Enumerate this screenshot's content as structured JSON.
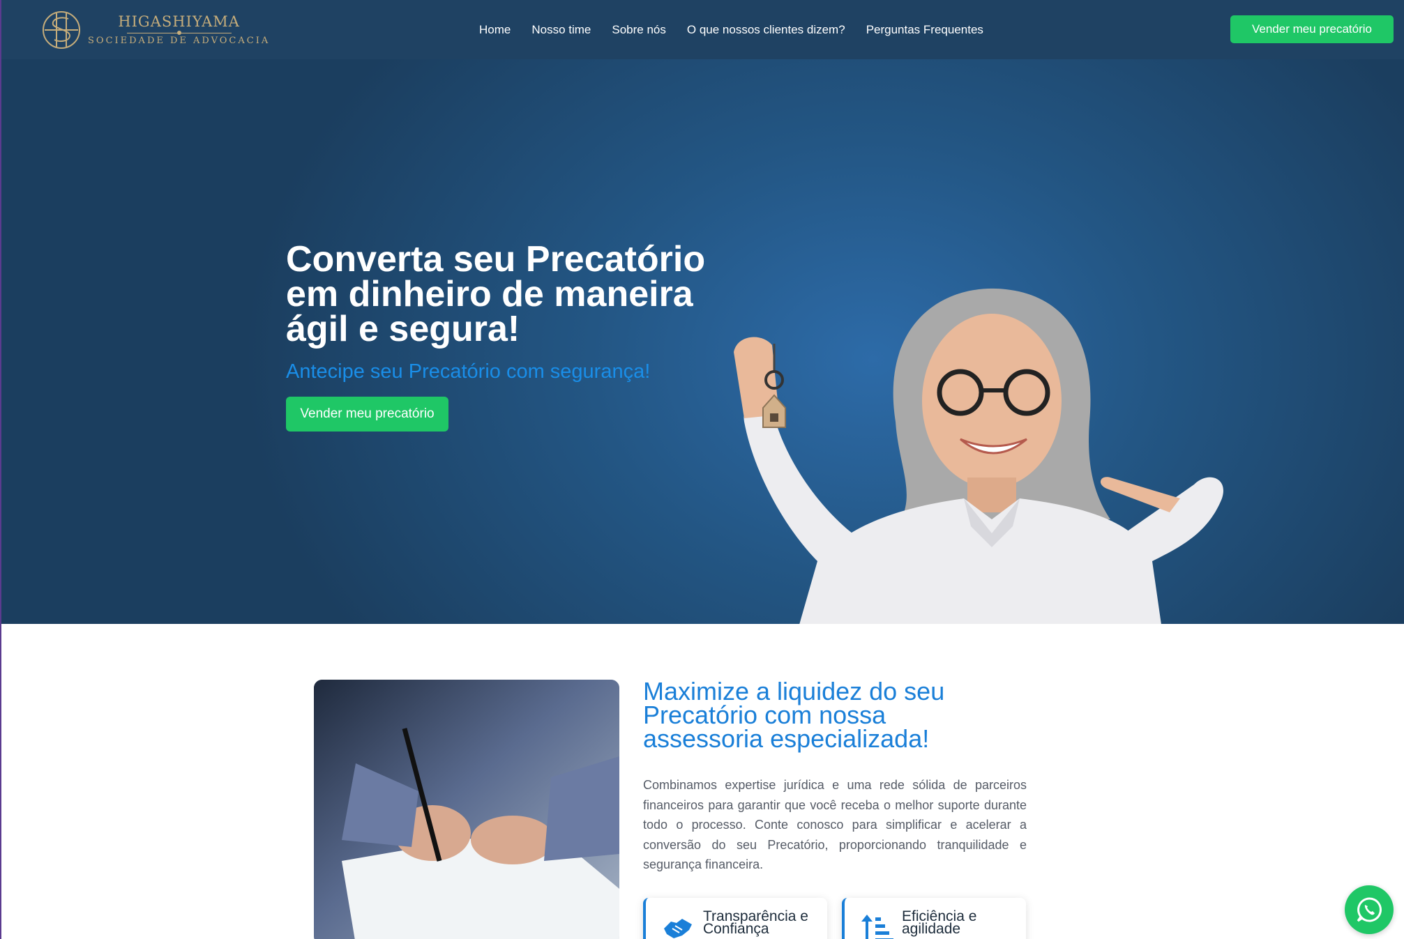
{
  "brand": {
    "name": "HIGASHIYAMA",
    "subtitle": "SOCIEDADE DE ADVOCACIA"
  },
  "nav": {
    "items": [
      "Home",
      "Nosso time",
      "Sobre nós",
      "O que nossos clientes dizem?",
      "Perguntas Frequentes"
    ],
    "cta_label": "Vender meu precatório"
  },
  "hero": {
    "title": "Converta seu Precatório em dinheiro de maneira ágil e segura!",
    "subtitle": "Antecipe seu Precatório com segurança!",
    "cta_label": "Vender meu precatório"
  },
  "section": {
    "title": "Maximize a liquidez do seu Precatório com nossa assessoria especializada!",
    "body": "Combinamos expertise jurídica e uma rede sólida de parceiros financeiros para garantir que você receba o melhor suporte durante todo o processo. Conte conosco para simplificar e acelerar a conversão do seu Precatório, proporcionando tranquilidade e segurança financeira.",
    "features": [
      {
        "label": "Transparência e Confiança",
        "icon": "handshake-icon"
      },
      {
        "label": "Eficiência e agilidade",
        "icon": "sort-ascending-icon"
      }
    ]
  },
  "colors": {
    "nav_bg": "#1f4263",
    "hero_bg": "#235684",
    "accent_green": "#1fc766",
    "accent_blue": "#1a7fd8",
    "gold": "#c6ad7b"
  },
  "floating": {
    "whatsapp_icon": "whatsapp-icon"
  }
}
